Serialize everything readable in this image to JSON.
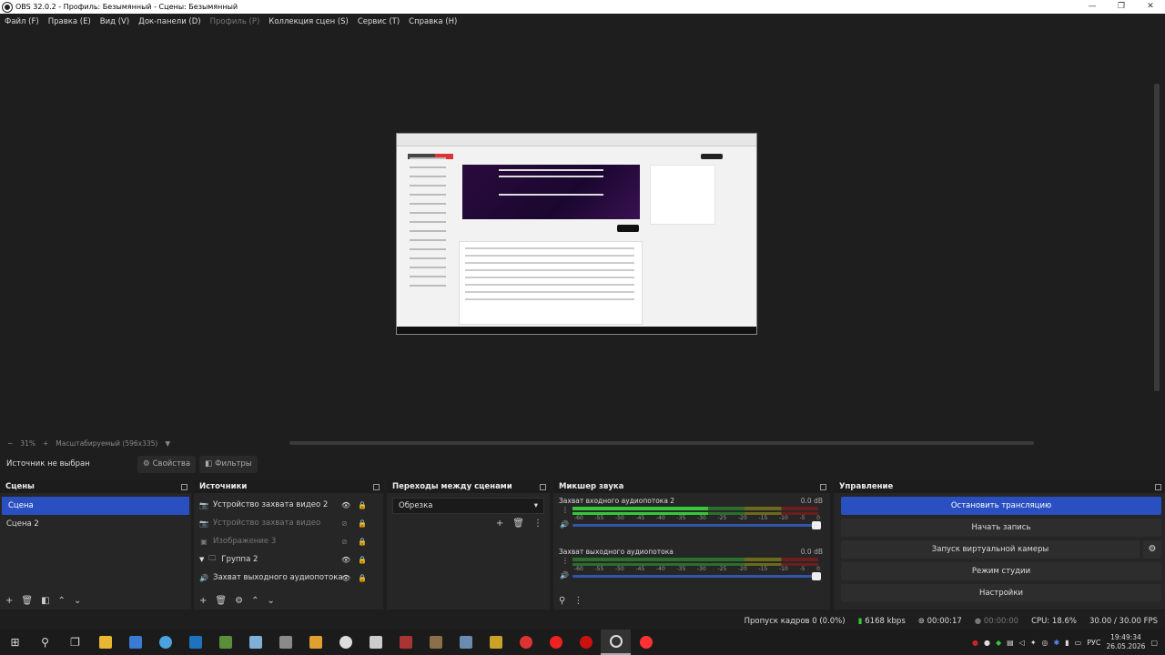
{
  "window": {
    "title": "OBS 32.0.2 - Профиль: Безымянный - Сцены: Безымянный",
    "controls": [
      "—",
      "❐",
      "✕"
    ]
  },
  "menu": [
    {
      "label": "Файл (F)",
      "disabled": false
    },
    {
      "label": "Правка (E)",
      "disabled": false
    },
    {
      "label": "Вид (V)",
      "disabled": false
    },
    {
      "label": "Док-панели (D)",
      "disabled": false
    },
    {
      "label": "Профиль (P)",
      "disabled": true
    },
    {
      "label": "Коллекция сцен (S)",
      "disabled": false
    },
    {
      "label": "Сервис (T)",
      "disabled": false
    },
    {
      "label": "Справка (H)",
      "disabled": false
    }
  ],
  "zoom": {
    "minus": "−",
    "value": "31%",
    "plus": "+",
    "mode": "Масштабируемый (596x335)"
  },
  "source_toolbar": {
    "no_source": "Источник не выбран",
    "properties": "Свойства",
    "filters": "Фильтры"
  },
  "scenes": {
    "title": "Сцены",
    "items": [
      {
        "label": "Сцена",
        "selected": true
      },
      {
        "label": "Сцена 2",
        "selected": false
      }
    ]
  },
  "sources": {
    "title": "Источники",
    "items": [
      {
        "label": "Устройство захвата видео 2",
        "icon": "camera-icon",
        "visible": true
      },
      {
        "label": "Устройство захвата видео",
        "icon": "camera-icon",
        "visible": false
      },
      {
        "label": "Изображение 3",
        "icon": "image-icon",
        "visible": false
      },
      {
        "label": "Группа 2",
        "icon": "folder-icon",
        "visible": true,
        "group": true
      },
      {
        "label": "Захват выходного аудиопотока",
        "icon": "speaker-icon",
        "visible": true
      }
    ]
  },
  "transitions": {
    "title": "Переходы между сценами",
    "selected": "Обрезка"
  },
  "mixer": {
    "title": "Микшер звука",
    "scale": [
      "-60",
      "-55",
      "-50",
      "-45",
      "-40",
      "-35",
      "-30",
      "-25",
      "-20",
      "-15",
      "-10",
      "-5",
      "0"
    ],
    "channels": [
      {
        "name": "Захват входного аудиопотока 2",
        "db": "0.0 dB",
        "level": 0.55
      },
      {
        "name": "Захват выходного аудиопотока",
        "db": "0.0 dB",
        "level": 0.0
      }
    ]
  },
  "controls": {
    "title": "Управление",
    "stop_stream": "Остановить трансляцию",
    "start_record": "Начать запись",
    "virtual_cam": "Запуск виртуальной камеры",
    "studio_mode": "Режим студии",
    "settings": "Настройки"
  },
  "status": {
    "dropped_frames": "Пропуск кадров 0 (0.0%)",
    "bitrate": "6168 kbps",
    "stream_time": "00:00:17",
    "record_time": "00:00:00",
    "cpu": "CPU: 18.6%",
    "fps": "30.00 / 30.00 FPS"
  },
  "taskbar": {
    "lang": "РУС",
    "time": "19:49:34",
    "date": "26.05.2026"
  },
  "colors": {
    "accent": "#2a4fc1",
    "meter_green": "#37c837"
  }
}
